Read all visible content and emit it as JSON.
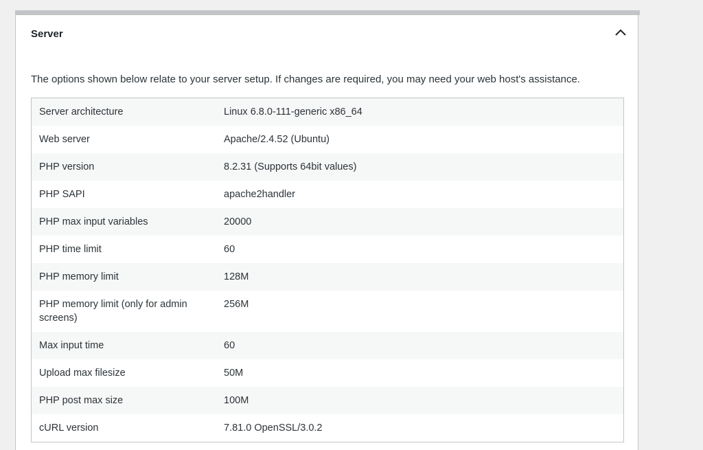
{
  "section": {
    "title": "Server",
    "toggle_icon": "chevron-up-icon",
    "description": "The options shown below relate to your server setup. If changes are required, you may need your web host's assistance."
  },
  "rows": [
    {
      "label": "Server architecture",
      "value": "Linux 6.8.0-111-generic x86_64"
    },
    {
      "label": "Web server",
      "value": "Apache/2.4.52 (Ubuntu)"
    },
    {
      "label": "PHP version",
      "value": "8.2.31 (Supports 64bit values)"
    },
    {
      "label": "PHP SAPI",
      "value": "apache2handler"
    },
    {
      "label": "PHP max input variables",
      "value": "20000"
    },
    {
      "label": "PHP time limit",
      "value": "60"
    },
    {
      "label": "PHP memory limit",
      "value": "128M"
    },
    {
      "label": "PHP memory limit (only for admin screens)",
      "value": "256M"
    },
    {
      "label": "Max input time",
      "value": "60"
    },
    {
      "label": "Upload max filesize",
      "value": "50M"
    },
    {
      "label": "PHP post max size",
      "value": "100M"
    },
    {
      "label": "cURL version",
      "value": "7.81.0 OpenSSL/3.0.2"
    }
  ]
}
